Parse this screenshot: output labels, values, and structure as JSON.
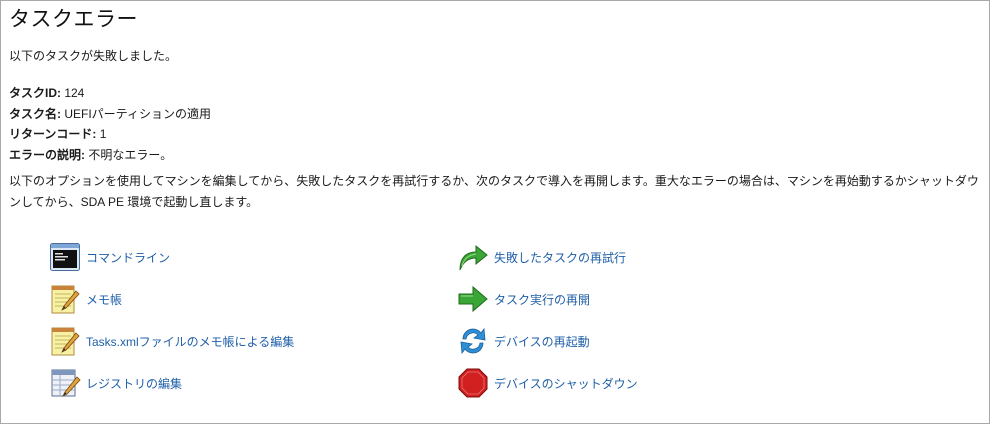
{
  "header": {
    "title": "タスクエラー"
  },
  "intro": "以下のタスクが失敗しました。",
  "details": {
    "task_id_label": "タスクID:",
    "task_id_value": " 124",
    "task_name_label": "タスク名:",
    "task_name_value": " UEFIパーティションの適用",
    "return_code_label": "リターンコード:",
    "return_code_value": " 1",
    "error_desc_label": "エラーの説明:",
    "error_desc_value": " 不明なエラー。"
  },
  "description": "以下のオプションを使用してマシンを編集してから、失敗したタスクを再試行するか、次のタスクで導入を再開します。重大なエラーの場合は、マシンを再始動するかシャットダウンしてから、SDA PE 環境で起動し直します。",
  "actions": {
    "command_line": {
      "label": "コマンドライン",
      "icon": "terminal-icon"
    },
    "notepad": {
      "label": "メモ帳",
      "icon": "notepad-icon"
    },
    "edit_tasks_xml": {
      "label": "Tasks.xmlファイルのメモ帳による編集",
      "icon": "notepad-edit-icon"
    },
    "edit_registry": {
      "label": "レジストリの編集",
      "icon": "registry-icon"
    },
    "retry_task": {
      "label": "失敗したタスクの再試行",
      "icon": "retry-arrow-icon"
    },
    "resume_tasks": {
      "label": "タスク実行の再開",
      "icon": "forward-arrow-icon"
    },
    "restart_device": {
      "label": "デバイスの再起動",
      "icon": "refresh-icon"
    },
    "shutdown_device": {
      "label": "デバイスのシャットダウン",
      "icon": "stop-sign-icon"
    }
  },
  "colors": {
    "link": "#1f5fa8",
    "border": "#a9a9a9",
    "arrow_green": "#3aa635",
    "stop_red": "#d21f1f",
    "refresh_blue": "#2e8fd6"
  }
}
